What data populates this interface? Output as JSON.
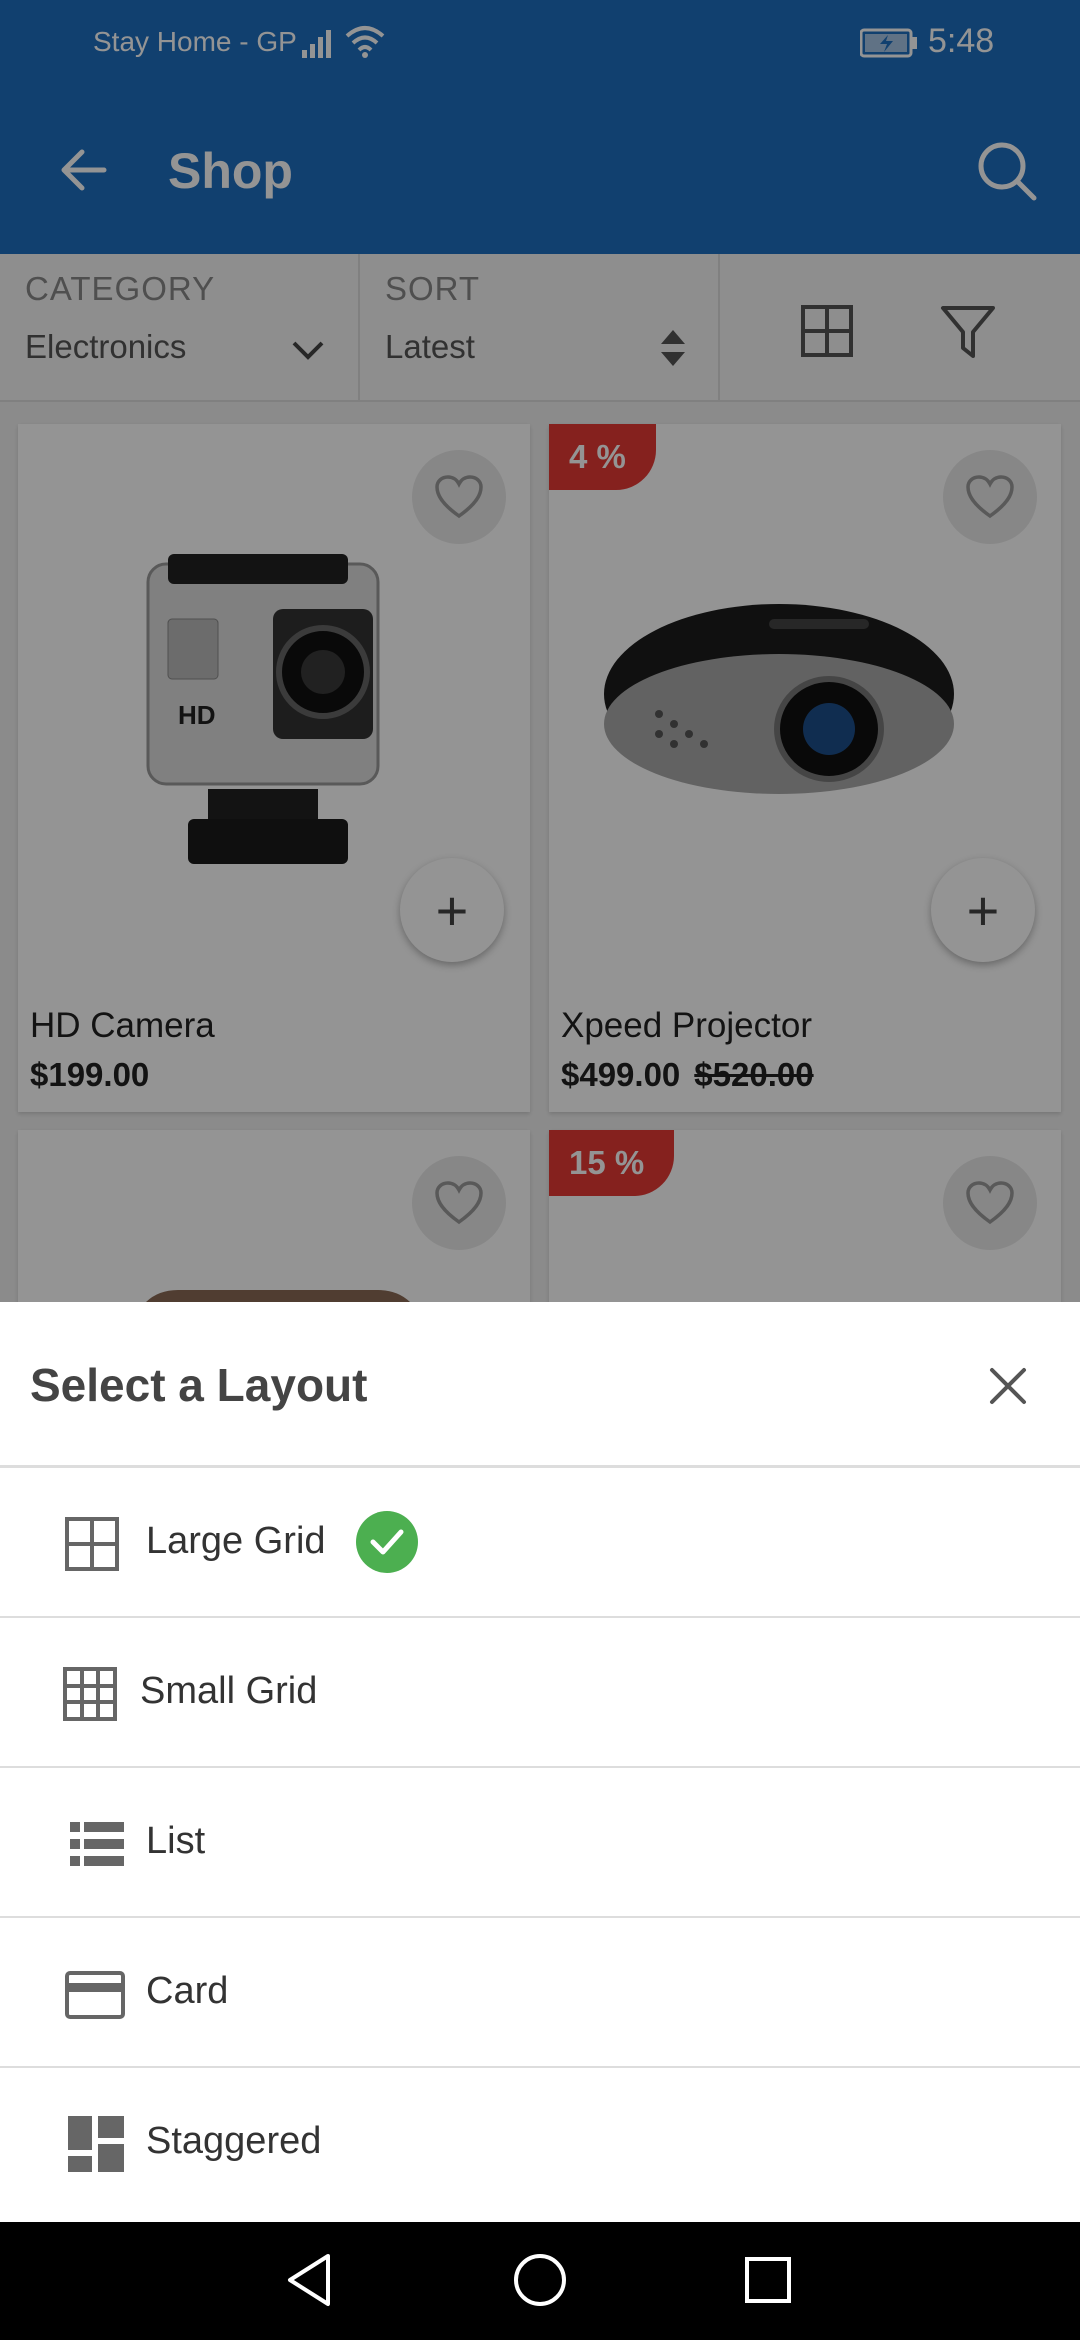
{
  "status_bar": {
    "carrier": "Stay Home - GP",
    "time": "5:48"
  },
  "app_bar": {
    "title": "Shop"
  },
  "filters": {
    "category_label": "CATEGORY",
    "category_value": "Electronics",
    "sort_label": "SORT",
    "sort_value": "Latest"
  },
  "products": [
    {
      "name": "HD Camera",
      "price": "$199.00"
    },
    {
      "name": "Xpeed Projector",
      "price": "$499.00",
      "old_price": "$520.00",
      "badge": "4 %"
    },
    {
      "badge": "15 %"
    }
  ],
  "sheet": {
    "title": "Select a Layout",
    "options": [
      {
        "label": "Large Grid",
        "icon": "large-grid-icon",
        "selected": true
      },
      {
        "label": "Small Grid",
        "icon": "small-grid-icon"
      },
      {
        "label": "List",
        "icon": "list-icon"
      },
      {
        "label": "Card",
        "icon": "card-icon"
      },
      {
        "label": "Staggered",
        "icon": "staggered-icon"
      }
    ]
  },
  "colors": {
    "primary": "#1e6fc0",
    "badge": "#e53935",
    "check": "#4caf50"
  }
}
